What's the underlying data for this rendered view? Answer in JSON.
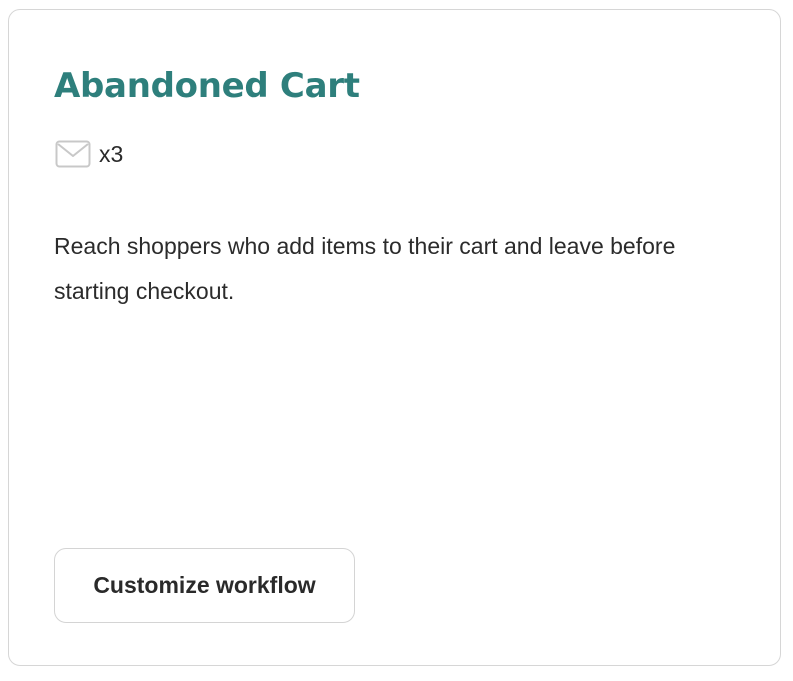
{
  "card": {
    "title": "Abandoned Cart",
    "email_count": "x3",
    "email_icon": "envelope-icon",
    "description": "Reach shoppers who add items to their cart and leave before starting checkout.",
    "button_label": "Customize workflow"
  },
  "colors": {
    "title": "#2e7f7c",
    "border": "#d6d6d6",
    "text": "#2a2a2a",
    "icon": "#c8c8c8"
  }
}
